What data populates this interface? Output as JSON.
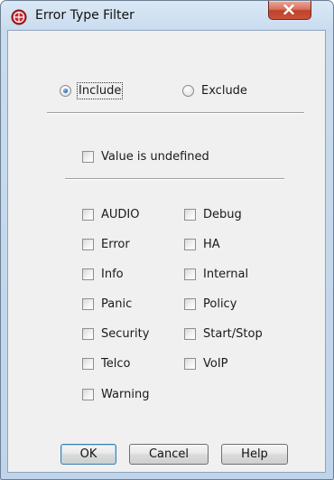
{
  "window": {
    "title": "Error Type Filter",
    "close_glyph": "x"
  },
  "mode": {
    "include_label": "Include",
    "exclude_label": "Exclude",
    "selected": "Include"
  },
  "undefined_option": {
    "label": "Value is undefined",
    "checked": false
  },
  "error_types": {
    "left": [
      {
        "label": "AUDIO",
        "checked": false
      },
      {
        "label": "Error",
        "checked": false
      },
      {
        "label": "Info",
        "checked": false
      },
      {
        "label": "Panic",
        "checked": false
      },
      {
        "label": "Security",
        "checked": false
      },
      {
        "label": "Telco",
        "checked": false
      },
      {
        "label": "Warning",
        "checked": false
      }
    ],
    "right": [
      {
        "label": "Debug",
        "checked": false
      },
      {
        "label": "HA",
        "checked": false
      },
      {
        "label": "Internal",
        "checked": false
      },
      {
        "label": "Policy",
        "checked": false
      },
      {
        "label": "Start/Stop",
        "checked": false
      },
      {
        "label": "VoIP",
        "checked": false
      }
    ]
  },
  "buttons": {
    "ok": "OK",
    "cancel": "Cancel",
    "help": "Help"
  },
  "colors": {
    "frame_blue": "#bfd4ea",
    "close_red": "#c9523a",
    "app_icon_red": "#c1272d",
    "dialog_bg": "#f0f0f0"
  }
}
